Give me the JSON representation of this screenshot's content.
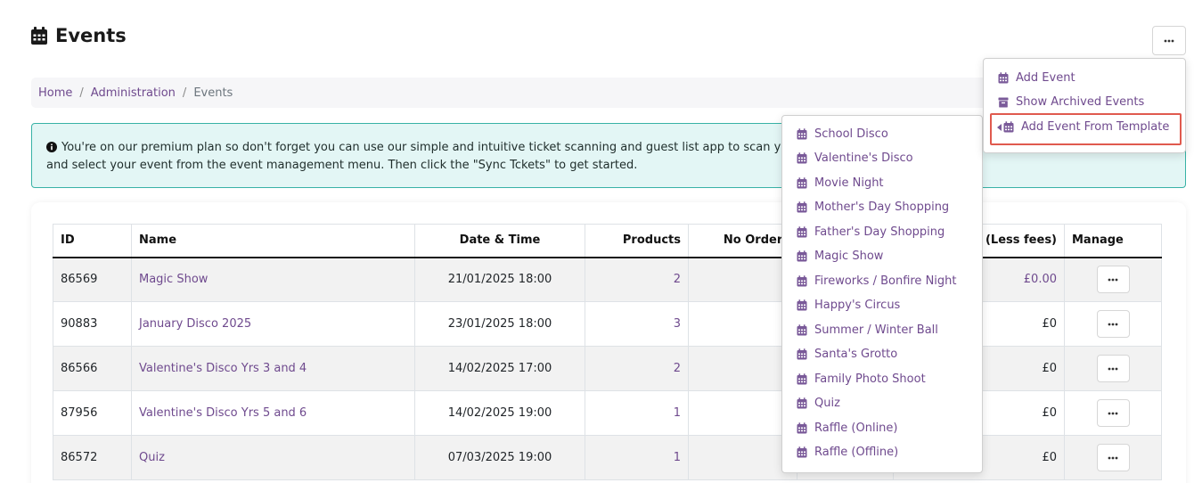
{
  "page": {
    "title": "Events",
    "icon": "calendar-icon"
  },
  "header": {
    "more_button_icon": "ellipsis-icon"
  },
  "breadcrumb": {
    "items": [
      "Home",
      "Administration",
      "Events"
    ],
    "separator": "/"
  },
  "alert": {
    "icon": "info-circle-icon",
    "line1": "You're on our premium plan so don't forget you can use our simple and intuitive ticket scanning and guest list app to scan yo",
    "line2": "and select your event from the event management menu. Then click the \"Sync Tckets\" to get started."
  },
  "table": {
    "headers": {
      "id": "ID",
      "name": "Name",
      "datetime": "Date & Time",
      "products": "Products",
      "orders": "No Orders",
      "col6": "",
      "sales": "es (Less fees)",
      "manage": "Manage"
    },
    "rows": [
      {
        "id": "86569",
        "name": "Magic Show",
        "datetime": "21/01/2025 18:00",
        "products": "2",
        "sales": "£0.00",
        "sales_link": true
      },
      {
        "id": "90883",
        "name": "January Disco 2025",
        "datetime": "23/01/2025 18:00",
        "products": "3",
        "sales": "£0",
        "sales_link": false
      },
      {
        "id": "86566",
        "name": "Valentine's Disco Yrs 3 and 4",
        "datetime": "14/02/2025 17:00",
        "products": "2",
        "sales": "£0",
        "sales_link": false
      },
      {
        "id": "87956",
        "name": "Valentine's Disco Yrs 5 and 6",
        "datetime": "14/02/2025 19:00",
        "products": "1",
        "sales": "£0",
        "sales_link": false
      },
      {
        "id": "86572",
        "name": "Quiz",
        "datetime": "07/03/2025 19:00",
        "products": "1",
        "sales": "£0",
        "sales_link": false
      }
    ]
  },
  "main_menu": {
    "items": [
      {
        "label": "Add Event",
        "icon": "calendar-icon"
      },
      {
        "label": "Show Archived Events",
        "icon": "archive-icon"
      },
      {
        "label": "Add Event From Template",
        "icon": "calendar-icon"
      }
    ]
  },
  "template_menu": {
    "items": [
      "School Disco",
      "Valentine's Disco",
      "Movie Night",
      "Mother's Day Shopping",
      "Father's Day Shopping",
      "Magic Show",
      "Fireworks / Bonfire Night",
      "Happy's Circus",
      "Summer / Winter Ball",
      "Santa's Grotto",
      "Family Photo Shoot",
      "Quiz",
      "Raffle (Online)",
      "Raffle (Offline)"
    ]
  },
  "colors": {
    "accent": "#6f4a8e",
    "alert_bg": "#e3f6f5",
    "alert_border": "#38b2a6",
    "highlight": "#e05a4e"
  }
}
